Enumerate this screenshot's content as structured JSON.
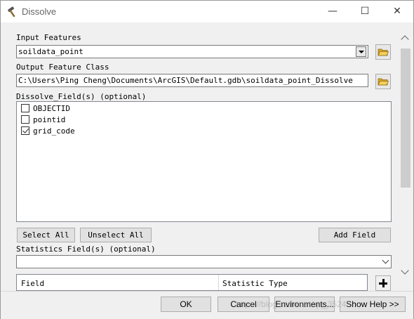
{
  "window": {
    "title": "Dissolve",
    "minimize_glyph": "—",
    "maximize_glyph": "☐",
    "close_glyph": "✕",
    "icon": "hammer-icon"
  },
  "input_features": {
    "label": "Input Features",
    "value": "soildata_point"
  },
  "output_feature_class": {
    "label": "Output Feature Class",
    "value": "C:\\Users\\Ping Cheng\\Documents\\ArcGIS\\Default.gdb\\soildata_point_Dissolve"
  },
  "dissolve_fields": {
    "label": "Dissolve_Field(s) (optional)",
    "items": [
      {
        "name": "OBJECTID",
        "checked": false
      },
      {
        "name": "pointid",
        "checked": false
      },
      {
        "name": "grid_code",
        "checked": true
      }
    ]
  },
  "buttons": {
    "select_all": "Select All",
    "unselect_all": "Unselect All",
    "add_field": "Add Field"
  },
  "statistics": {
    "label": "Statistics Field(s) (optional)",
    "col_field": "Field",
    "col_stat_type": "Statistic Type"
  },
  "footer": {
    "ok": "OK",
    "cancel": "Cancel",
    "environments": "Environments...",
    "show_help": "Show Help >>"
  },
  "watermark": "https://blog.csdn.net/qq_35245",
  "colors": {
    "folder_yellow": "#e8b73a",
    "window_bg": "#f0f0f0"
  }
}
